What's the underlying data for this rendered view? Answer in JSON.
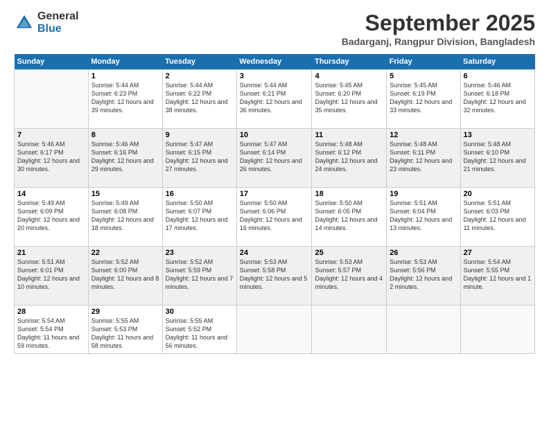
{
  "logo": {
    "general": "General",
    "blue": "Blue"
  },
  "title": "September 2025",
  "location": "Badarganj, Rangpur Division, Bangladesh",
  "days_of_week": [
    "Sunday",
    "Monday",
    "Tuesday",
    "Wednesday",
    "Thursday",
    "Friday",
    "Saturday"
  ],
  "weeks": [
    [
      {
        "num": "",
        "sunrise": "",
        "sunset": "",
        "daylight": "",
        "empty": true
      },
      {
        "num": "1",
        "sunrise": "Sunrise: 5:44 AM",
        "sunset": "Sunset: 6:23 PM",
        "daylight": "Daylight: 12 hours and 39 minutes."
      },
      {
        "num": "2",
        "sunrise": "Sunrise: 5:44 AM",
        "sunset": "Sunset: 6:22 PM",
        "daylight": "Daylight: 12 hours and 38 minutes."
      },
      {
        "num": "3",
        "sunrise": "Sunrise: 5:44 AM",
        "sunset": "Sunset: 6:21 PM",
        "daylight": "Daylight: 12 hours and 36 minutes."
      },
      {
        "num": "4",
        "sunrise": "Sunrise: 5:45 AM",
        "sunset": "Sunset: 6:20 PM",
        "daylight": "Daylight: 12 hours and 35 minutes."
      },
      {
        "num": "5",
        "sunrise": "Sunrise: 5:45 AM",
        "sunset": "Sunset: 6:19 PM",
        "daylight": "Daylight: 12 hours and 33 minutes."
      },
      {
        "num": "6",
        "sunrise": "Sunrise: 5:46 AM",
        "sunset": "Sunset: 6:18 PM",
        "daylight": "Daylight: 12 hours and 32 minutes."
      }
    ],
    [
      {
        "num": "7",
        "sunrise": "Sunrise: 5:46 AM",
        "sunset": "Sunset: 6:17 PM",
        "daylight": "Daylight: 12 hours and 30 minutes."
      },
      {
        "num": "8",
        "sunrise": "Sunrise: 5:46 AM",
        "sunset": "Sunset: 6:16 PM",
        "daylight": "Daylight: 12 hours and 29 minutes."
      },
      {
        "num": "9",
        "sunrise": "Sunrise: 5:47 AM",
        "sunset": "Sunset: 6:15 PM",
        "daylight": "Daylight: 12 hours and 27 minutes."
      },
      {
        "num": "10",
        "sunrise": "Sunrise: 5:47 AM",
        "sunset": "Sunset: 6:14 PM",
        "daylight": "Daylight: 12 hours and 26 minutes."
      },
      {
        "num": "11",
        "sunrise": "Sunrise: 5:48 AM",
        "sunset": "Sunset: 6:12 PM",
        "daylight": "Daylight: 12 hours and 24 minutes."
      },
      {
        "num": "12",
        "sunrise": "Sunrise: 5:48 AM",
        "sunset": "Sunset: 6:11 PM",
        "daylight": "Daylight: 12 hours and 23 minutes."
      },
      {
        "num": "13",
        "sunrise": "Sunrise: 5:48 AM",
        "sunset": "Sunset: 6:10 PM",
        "daylight": "Daylight: 12 hours and 21 minutes."
      }
    ],
    [
      {
        "num": "14",
        "sunrise": "Sunrise: 5:49 AM",
        "sunset": "Sunset: 6:09 PM",
        "daylight": "Daylight: 12 hours and 20 minutes."
      },
      {
        "num": "15",
        "sunrise": "Sunrise: 5:49 AM",
        "sunset": "Sunset: 6:08 PM",
        "daylight": "Daylight: 12 hours and 18 minutes."
      },
      {
        "num": "16",
        "sunrise": "Sunrise: 5:50 AM",
        "sunset": "Sunset: 6:07 PM",
        "daylight": "Daylight: 12 hours and 17 minutes."
      },
      {
        "num": "17",
        "sunrise": "Sunrise: 5:50 AM",
        "sunset": "Sunset: 6:06 PM",
        "daylight": "Daylight: 12 hours and 16 minutes."
      },
      {
        "num": "18",
        "sunrise": "Sunrise: 5:50 AM",
        "sunset": "Sunset: 6:05 PM",
        "daylight": "Daylight: 12 hours and 14 minutes."
      },
      {
        "num": "19",
        "sunrise": "Sunrise: 5:51 AM",
        "sunset": "Sunset: 6:04 PM",
        "daylight": "Daylight: 12 hours and 13 minutes."
      },
      {
        "num": "20",
        "sunrise": "Sunrise: 5:51 AM",
        "sunset": "Sunset: 6:03 PM",
        "daylight": "Daylight: 12 hours and 11 minutes."
      }
    ],
    [
      {
        "num": "21",
        "sunrise": "Sunrise: 5:51 AM",
        "sunset": "Sunset: 6:01 PM",
        "daylight": "Daylight: 12 hours and 10 minutes."
      },
      {
        "num": "22",
        "sunrise": "Sunrise: 5:52 AM",
        "sunset": "Sunset: 6:00 PM",
        "daylight": "Daylight: 12 hours and 8 minutes."
      },
      {
        "num": "23",
        "sunrise": "Sunrise: 5:52 AM",
        "sunset": "Sunset: 5:59 PM",
        "daylight": "Daylight: 12 hours and 7 minutes."
      },
      {
        "num": "24",
        "sunrise": "Sunrise: 5:53 AM",
        "sunset": "Sunset: 5:58 PM",
        "daylight": "Daylight: 12 hours and 5 minutes."
      },
      {
        "num": "25",
        "sunrise": "Sunrise: 5:53 AM",
        "sunset": "Sunset: 5:57 PM",
        "daylight": "Daylight: 12 hours and 4 minutes."
      },
      {
        "num": "26",
        "sunrise": "Sunrise: 5:53 AM",
        "sunset": "Sunset: 5:56 PM",
        "daylight": "Daylight: 12 hours and 2 minutes."
      },
      {
        "num": "27",
        "sunrise": "Sunrise: 5:54 AM",
        "sunset": "Sunset: 5:55 PM",
        "daylight": "Daylight: 12 hours and 1 minute."
      }
    ],
    [
      {
        "num": "28",
        "sunrise": "Sunrise: 5:54 AM",
        "sunset": "Sunset: 5:54 PM",
        "daylight": "Daylight: 11 hours and 59 minutes."
      },
      {
        "num": "29",
        "sunrise": "Sunrise: 5:55 AM",
        "sunset": "Sunset: 5:53 PM",
        "daylight": "Daylight: 11 hours and 58 minutes."
      },
      {
        "num": "30",
        "sunrise": "Sunrise: 5:55 AM",
        "sunset": "Sunset: 5:52 PM",
        "daylight": "Daylight: 11 hours and 56 minutes."
      },
      {
        "num": "",
        "sunrise": "",
        "sunset": "",
        "daylight": "",
        "empty": true
      },
      {
        "num": "",
        "sunrise": "",
        "sunset": "",
        "daylight": "",
        "empty": true
      },
      {
        "num": "",
        "sunrise": "",
        "sunset": "",
        "daylight": "",
        "empty": true
      },
      {
        "num": "",
        "sunrise": "",
        "sunset": "",
        "daylight": "",
        "empty": true
      }
    ]
  ]
}
